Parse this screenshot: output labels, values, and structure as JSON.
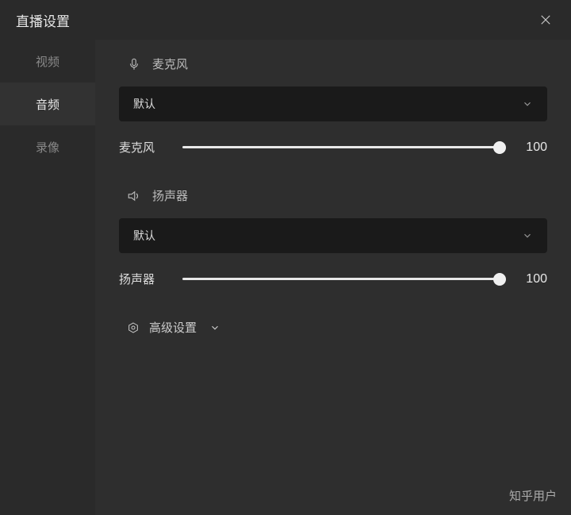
{
  "title": "直播设置",
  "sidebar": {
    "items": [
      {
        "label": "视频"
      },
      {
        "label": "音频"
      },
      {
        "label": "录像"
      }
    ],
    "active_index": 1
  },
  "audio": {
    "microphone": {
      "heading": "麦克风",
      "dropdown_selected": "默认",
      "slider_label": "麦克风",
      "slider_value": "100"
    },
    "speaker": {
      "heading": "扬声器",
      "dropdown_selected": "默认",
      "slider_label": "扬声器",
      "slider_value": "100"
    },
    "advanced_label": "高级设置"
  },
  "watermark": "知乎用户"
}
